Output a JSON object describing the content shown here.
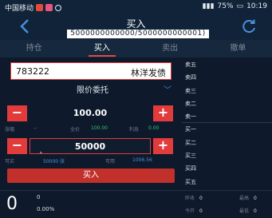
{
  "status_bar": {
    "carrier": "中国移动",
    "battery": "75%",
    "time": "10:19"
  },
  "header": {
    "title": "买入",
    "subtitle": "5000000000000/5000000000001)"
  },
  "tabs": [
    "持仓",
    "买入",
    "卖出",
    "撤单"
  ],
  "active_tab": 1,
  "stock": {
    "code": "783222",
    "name": "林洋发债"
  },
  "order_type": "限价委托",
  "price": "100.00",
  "limits": {
    "down_label": "涨幅",
    "down_value": "--",
    "mid_label": "全价",
    "mid_value": "100.00",
    "right_label": "利息",
    "right_value": "0.00"
  },
  "quantity": "50000",
  "quantity_hint": "⌞",
  "avail": {
    "left_label": "可买",
    "left_value": "50000 张",
    "right_label": "可用",
    "right_value": "1006.56"
  },
  "buy_button": "买入",
  "order_book": [
    "卖五",
    "卖四",
    "卖三",
    "卖二",
    "卖一",
    "买一",
    "买二",
    "买三",
    "买四",
    "买五"
  ],
  "bottom": {
    "price": "0",
    "change": "0",
    "change_pct": "0.00%",
    "prev_close_label": "昨收",
    "prev_close_value": "0",
    "open_label": "今开",
    "open_value": "0",
    "high_label": "最高",
    "high_value": "0",
    "low_label": "最低",
    "low_value": "0"
  },
  "colors": {
    "accent": "#e23b3b",
    "link": "#4a8fe0",
    "background": "#0e1a2b"
  }
}
